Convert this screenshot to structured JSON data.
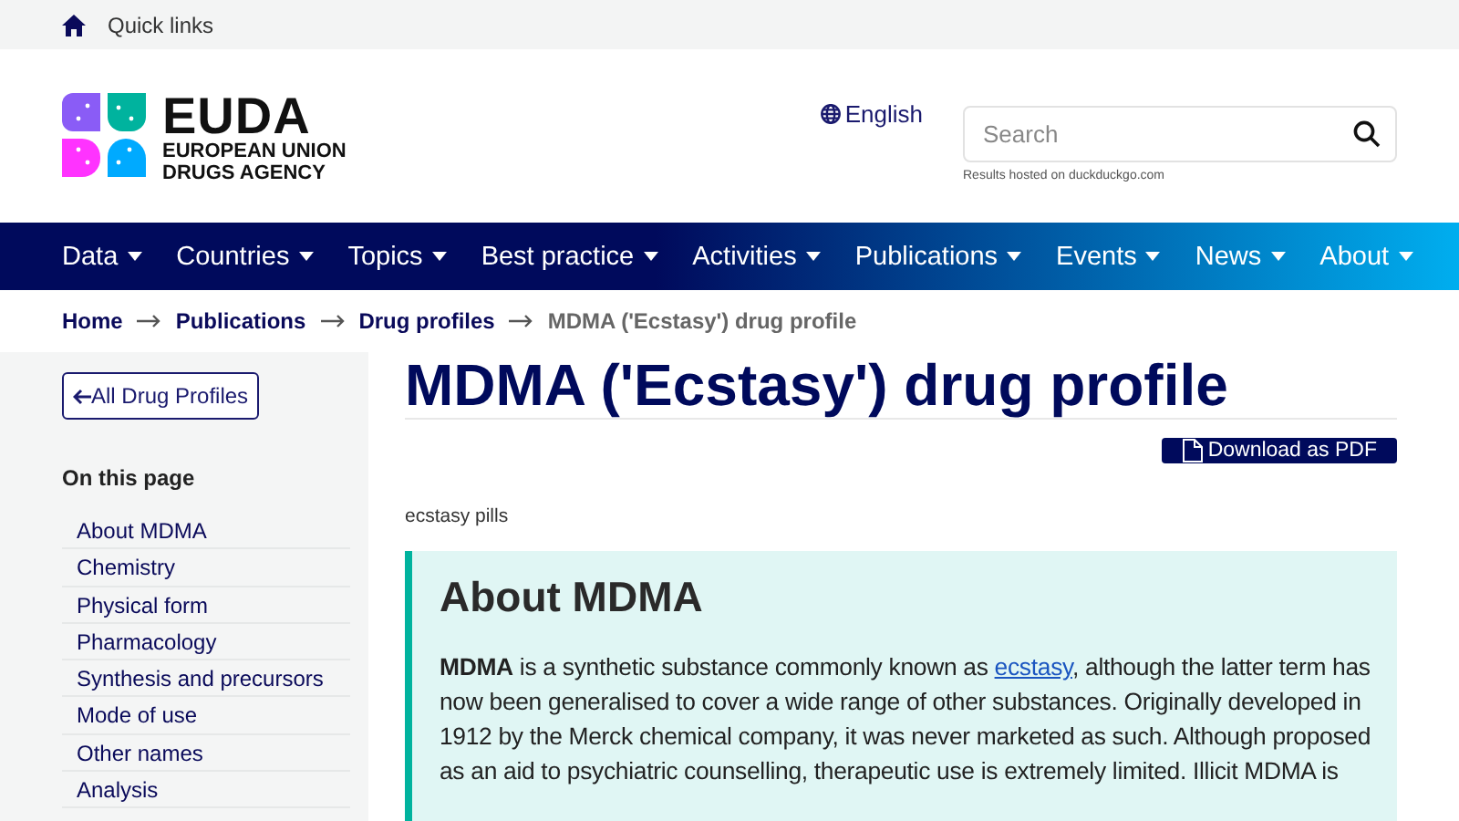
{
  "top_bar": {
    "quick_links": "Quick links"
  },
  "logo": {
    "name": "EUDA",
    "line_1": "EUROPEAN UNION",
    "line_2": "DRUGS AGENCY"
  },
  "language": "English",
  "search": {
    "placeholder": "Search",
    "note": "Results hosted on duckduckgo.com"
  },
  "nav": [
    "Data",
    "Countries",
    "Topics",
    "Best practice",
    "Activities",
    "Publications",
    "Events",
    "News",
    "About"
  ],
  "breadcrumb": [
    {
      "label": "Home",
      "current": false
    },
    {
      "label": "Publications",
      "current": false
    },
    {
      "label": "Drug profiles",
      "current": false
    },
    {
      "label": "MDMA ('Ecstasy') drug profile",
      "current": true
    }
  ],
  "sidebar": {
    "back_button": "All Drug Profiles",
    "heading": "On this page",
    "items": [
      "About MDMA",
      "Chemistry",
      "Physical form",
      "Pharmacology",
      "Synthesis and precursors",
      "Mode of use",
      "Other names",
      "Analysis"
    ]
  },
  "title": "MDMA ('Ecstasy') drug profile",
  "download_button": "Download as PDF",
  "caption": "ecstasy pills",
  "section": {
    "heading": "About MDMA",
    "before": "**MDMA** is a synthetic substance commonly known as ",
    "link": "ecstasy",
    "after": ", although the latter term has now been generalised to cover a wide range of other substances. Originally developed in 1912 by the Merck chemical company, it was never marketed as such. Although proposed as an aid to psychiatric counselling, therapeutic use is extremely limited. Illicit MDMA is"
  }
}
